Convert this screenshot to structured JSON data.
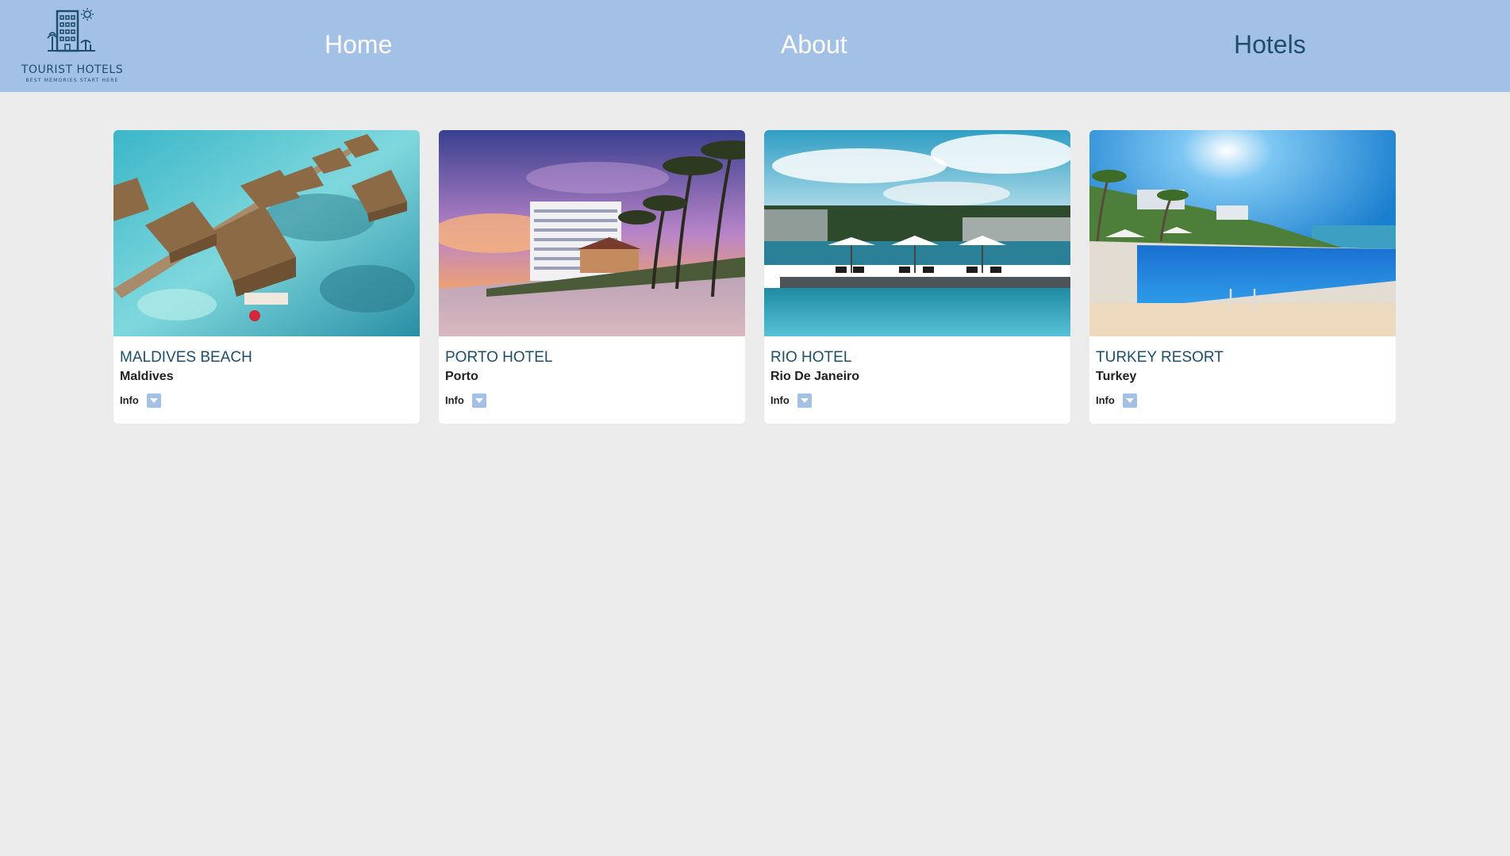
{
  "colors": {
    "navbar": "#a3c0e7",
    "accent": "#1f4e6b",
    "page_bg": "#ececec",
    "card_bg": "#ffffff"
  },
  "logo": {
    "title": "TOURIST HOTELS",
    "tagline": "BEST MEMORIES START HERE",
    "icon": "hotel-building-icon"
  },
  "nav": {
    "items": [
      {
        "label": "Home",
        "active": false
      },
      {
        "label": "About",
        "active": false
      },
      {
        "label": "Hotels",
        "active": true
      }
    ]
  },
  "hotels": [
    {
      "name": "MALDIVES BEACH",
      "location": "Maldives",
      "info_label": "Info",
      "photo": "overwater-bungalows-photo",
      "toggle_icon": "chevron-down-icon"
    },
    {
      "name": "PORTO HOTEL",
      "location": "Porto",
      "info_label": "Info",
      "photo": "beach-tower-sunset-photo",
      "toggle_icon": "chevron-down-icon"
    },
    {
      "name": "RIO HOTEL",
      "location": "Rio De Janeiro",
      "info_label": "Info",
      "photo": "pool-umbrellas-photo",
      "toggle_icon": "chevron-down-icon"
    },
    {
      "name": "TURKEY RESORT",
      "location": "Turkey",
      "info_label": "Info",
      "photo": "infinity-pool-seaside-photo",
      "toggle_icon": "chevron-down-icon"
    }
  ]
}
